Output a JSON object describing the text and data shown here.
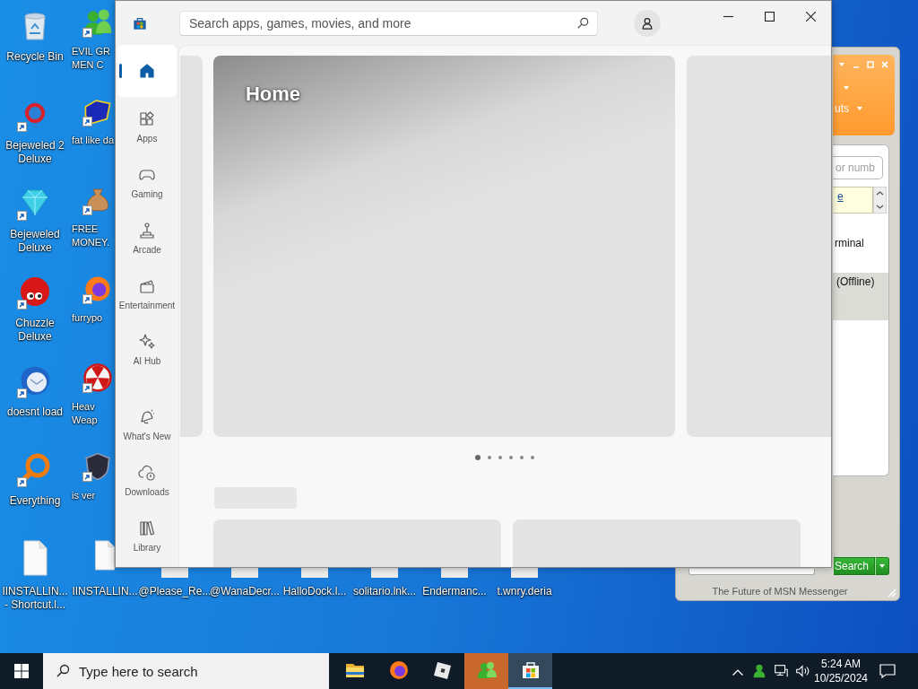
{
  "desktop": {
    "icon_columns": [
      [
        {
          "label": "Recycle Bin",
          "kind": "bin",
          "shortcut": false
        },
        {
          "label": "Bejeweled 2\nDeluxe",
          "kind": "gem2",
          "shortcut": true
        },
        {
          "label": "Bejeweled\nDeluxe",
          "kind": "gem",
          "shortcut": true
        },
        {
          "label": "Chuzzle\nDeluxe",
          "kind": "fuzzball",
          "shortcut": true
        },
        {
          "label": "doesnt load",
          "kind": "bird",
          "shortcut": true
        },
        {
          "label": "Everything",
          "kind": "magnifier",
          "shortcut": true
        }
      ],
      [
        {
          "label": "EVIL GR\nMEN C",
          "kind": "people",
          "shortcut": true
        },
        {
          "label": "fat like da",
          "kind": "emblem",
          "shortcut": true
        },
        {
          "label": "FREE\nMONEY.",
          "kind": "moneybag",
          "shortcut": true
        },
        {
          "label": "furrypo",
          "kind": "browser",
          "shortcut": true
        },
        {
          "label": "Heav\nWeap",
          "kind": "hazard",
          "shortcut": true
        },
        {
          "label": "is ver",
          "kind": "shield",
          "shortcut": true
        }
      ]
    ],
    "bottom_row": [
      {
        "label": "IINSTALLIN...\n- Shortcut.l...",
        "kind": "file",
        "shortcut": false
      },
      {
        "label": "IINSTALLIN...",
        "kind": "file_narrow",
        "shortcut": false
      },
      {
        "label": "@Please_Re...",
        "kind": "file_edge",
        "shortcut": false
      },
      {
        "label": "@WanaDecr...",
        "kind": "file_edge",
        "shortcut": false
      },
      {
        "label": "HalloDock.l...",
        "kind": "file_edge",
        "shortcut": false
      },
      {
        "label": "solitario.lnk...",
        "kind": "file_edge",
        "shortcut": false
      },
      {
        "label": "Endermanc...",
        "kind": "file_edge",
        "shortcut": false
      },
      {
        "label": "t.wnry.deria",
        "kind": "file_edge",
        "shortcut": false
      }
    ]
  },
  "messenger_window": {
    "menu_fragment": "uts",
    "search_placeholder": "or numb",
    "link_fragment": "e",
    "contact_fragment": "rminal",
    "status_fragment": "(Offline)",
    "search_button": "Search",
    "footer": "The Future of MSN Messenger"
  },
  "store_window": {
    "search": {
      "placeholder": "Search apps, games, movies, and more"
    },
    "nav_top": [
      {
        "kind": "home",
        "selected": true
      },
      {
        "kind": "apps",
        "label": "Apps",
        "selected": false
      },
      {
        "kind": "gaming",
        "label": "Gaming",
        "selected": false
      },
      {
        "kind": "arcade",
        "label": "Arcade",
        "selected": false
      },
      {
        "kind": "entertainment",
        "label": "Entertainment",
        "selected": false
      },
      {
        "kind": "ai",
        "label": "AI Hub",
        "selected": false
      }
    ],
    "nav_bottom": [
      {
        "kind": "new",
        "label": "What's New",
        "selected": false
      },
      {
        "kind": "downloads",
        "label": "Downloads",
        "selected": false
      },
      {
        "kind": "library",
        "label": "Library",
        "selected": false
      }
    ],
    "hero": {
      "title": "Home"
    },
    "carousel_dots": [
      {
        "selected": true
      },
      {
        "selected": false
      },
      {
        "selected": false
      },
      {
        "selected": false
      },
      {
        "selected": false
      },
      {
        "selected": false
      }
    ]
  },
  "taskbar": {
    "search": {
      "placeholder": "Type here to search"
    },
    "apps": [
      {
        "kind": "folder",
        "selected": false,
        "flashing": false
      },
      {
        "kind": "firefox",
        "selected": false,
        "flashing": false
      },
      {
        "kind": "roblox",
        "selected": false,
        "flashing": false
      },
      {
        "kind": "messenger",
        "selected": false,
        "flashing": true
      },
      {
        "kind": "store",
        "selected": true,
        "flashing": false
      }
    ],
    "time": "5:24 AM",
    "date": "10/25/2024"
  }
}
